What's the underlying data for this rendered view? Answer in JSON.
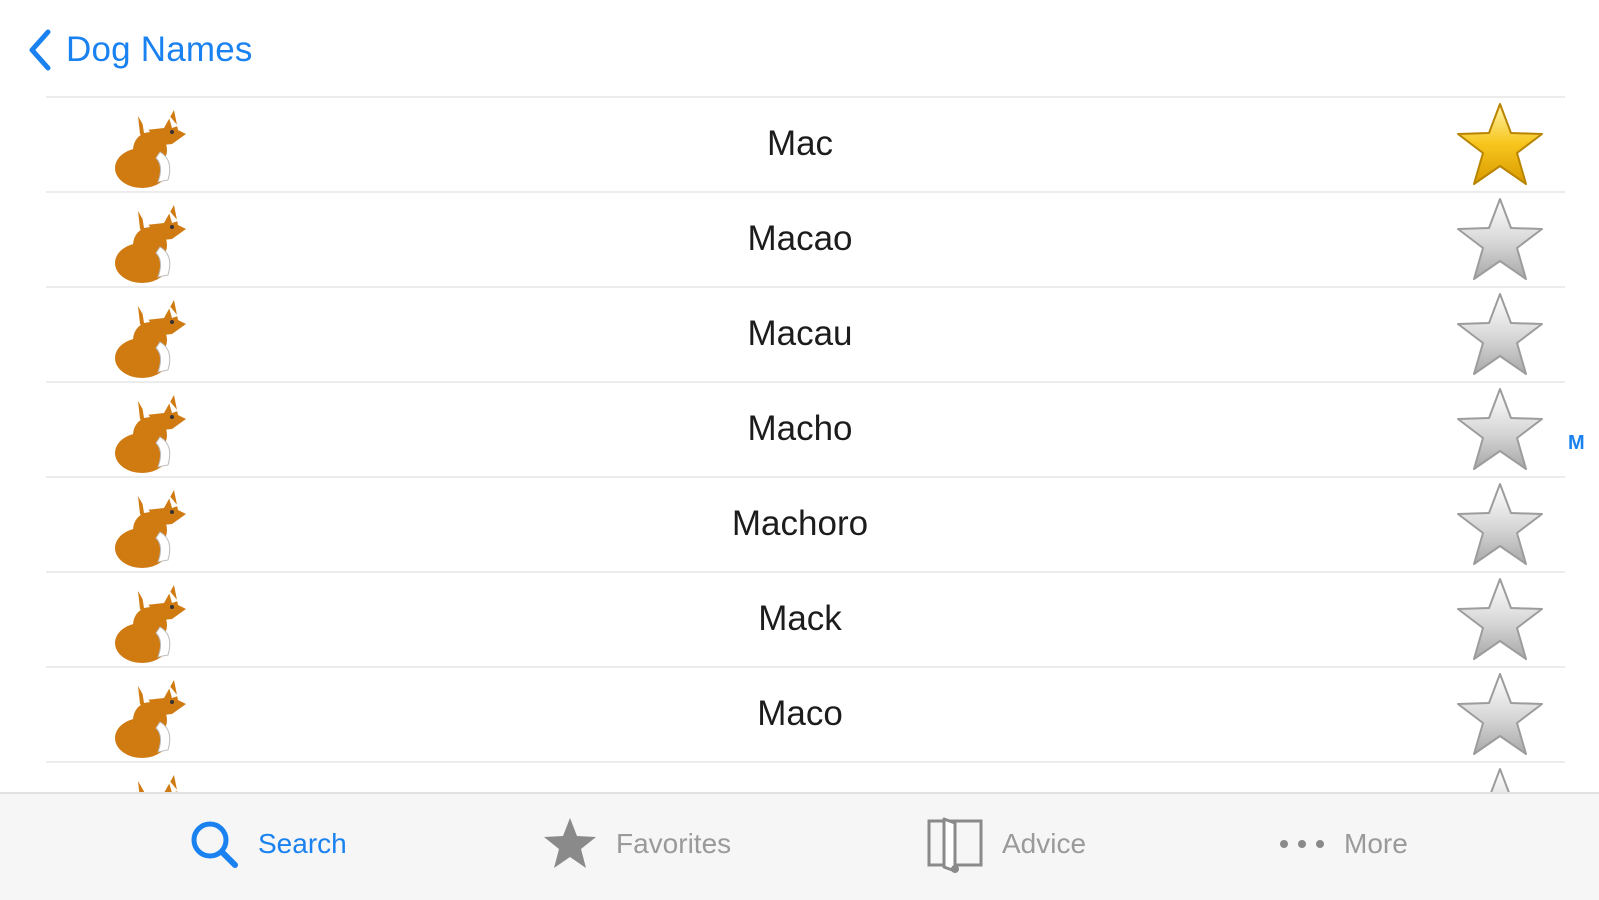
{
  "navbar": {
    "back_label": "Dog Names"
  },
  "list": {
    "rows": [
      {
        "name": "Mac",
        "favorite": true
      },
      {
        "name": "Macao",
        "favorite": false
      },
      {
        "name": "Macau",
        "favorite": false
      },
      {
        "name": "Macho",
        "favorite": false
      },
      {
        "name": "Machoro",
        "favorite": false
      },
      {
        "name": "Mack",
        "favorite": false
      },
      {
        "name": "Maco",
        "favorite": false
      },
      {
        "name": "",
        "favorite": false
      }
    ],
    "section_index": "M"
  },
  "tabbar": {
    "tabs": [
      {
        "label": "Search",
        "icon": "search-icon",
        "active": true
      },
      {
        "label": "Favorites",
        "icon": "star-icon",
        "active": false
      },
      {
        "label": "Advice",
        "icon": "book-icon",
        "active": false
      },
      {
        "label": "More",
        "icon": "more-icon",
        "active": false
      }
    ]
  },
  "colors": {
    "accent": "#1a82f0",
    "dog": "#d07a12",
    "favorite_star": "#f5c518",
    "inactive_star": "#c8c8c8",
    "tab_inactive": "#9a9a9a"
  }
}
